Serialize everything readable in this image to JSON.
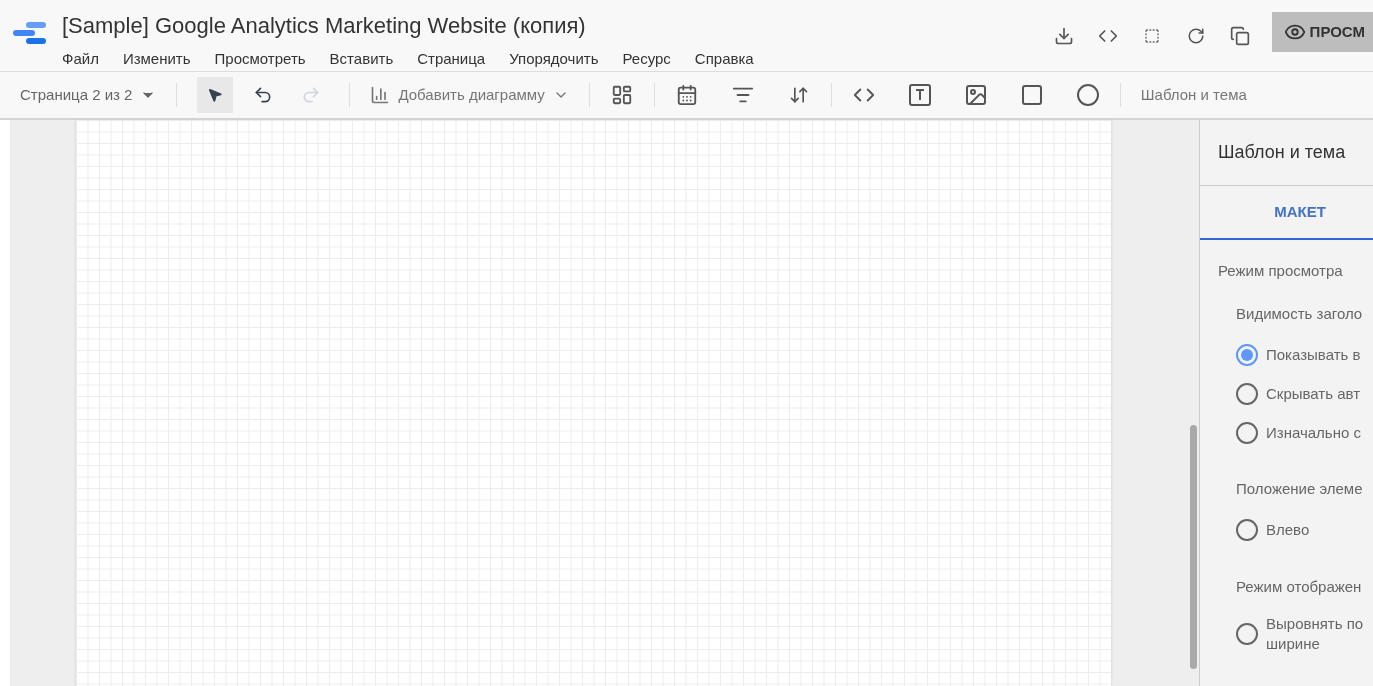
{
  "report": {
    "title": "[Sample] Google Analytics Marketing Website (копия)"
  },
  "menu": [
    "Файл",
    "Изменить",
    "Просмотреть",
    "Вставить",
    "Страница",
    "Упорядочить",
    "Ресурс",
    "Справка"
  ],
  "header_actions": {
    "view_button": "ПРОСМ"
  },
  "toolbar": {
    "page_selector": "Страница 2 из 2",
    "tools": [
      {
        "kind": "select",
        "selected": true,
        "disabled": false
      },
      {
        "kind": "undo",
        "selected": false,
        "disabled": false
      },
      {
        "kind": "redo",
        "selected": false,
        "disabled": true
      }
    ],
    "add_chart": "Добавить диаграмму",
    "theme_button": "Шаблон и тема"
  },
  "panel": {
    "title": "Шаблон и тема",
    "tabs": [
      {
        "label": "МАКЕТ",
        "selected": true
      }
    ],
    "sections": [
      {
        "kind": "heading",
        "text": "Режим просмотра"
      },
      {
        "kind": "subheading",
        "text": "Видимость заголо"
      },
      {
        "kind": "radio",
        "text": "Показывать в",
        "selected": true
      },
      {
        "kind": "radio",
        "text": "Скрывать авт",
        "selected": false
      },
      {
        "kind": "radio",
        "text": "Изначально с",
        "selected": false
      },
      {
        "kind": "subheading",
        "text": "Положение элеме"
      },
      {
        "kind": "radio",
        "text": "Влево",
        "selected": false
      },
      {
        "kind": "subheading",
        "text": "Режим отображен"
      },
      {
        "kind": "radio",
        "text": "Выровнять по ширине",
        "selected": false
      }
    ]
  }
}
